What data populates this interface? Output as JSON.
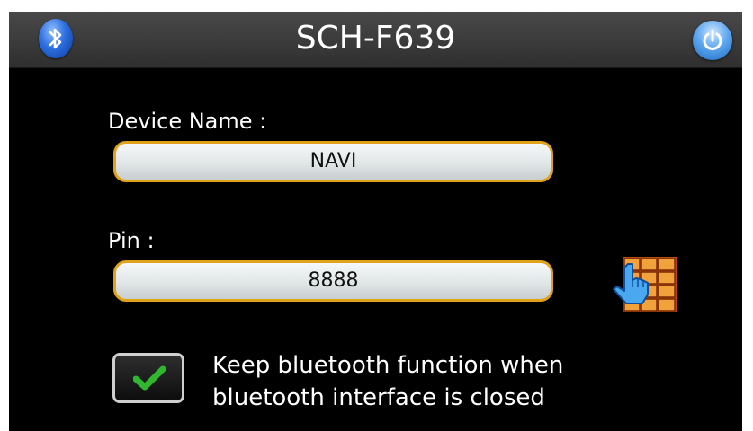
{
  "header": {
    "title": "SCH-F639",
    "left_icon": "bluetooth-icon",
    "right_icon": "power-icon"
  },
  "form": {
    "device_name_label": "Device Name :",
    "device_name_value": "NAVI",
    "pin_label": "Pin :",
    "pin_value": "8888",
    "keypad_icon": "keypad-touch-icon"
  },
  "option": {
    "checked": true,
    "text_line1": "Keep bluetooth function when",
    "text_line2": "bluetooth interface is closed"
  },
  "colors": {
    "field_border": "#e0a21a",
    "header_bg": "#3a3a3a",
    "check_green": "#2fb82f"
  }
}
